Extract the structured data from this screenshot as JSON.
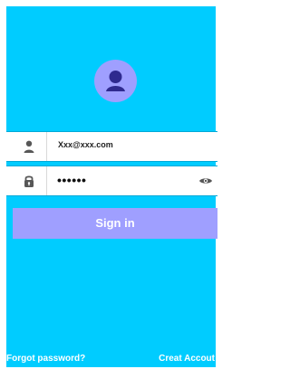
{
  "colors": {
    "background": "#00ccff",
    "accent": "#9f9fff",
    "field_background": "#ffffff",
    "text_light": "#ffffff",
    "text_dark": "#1f1f1f"
  },
  "avatar": {
    "icon": "user-avatar-icon"
  },
  "email": {
    "icon": "person-icon",
    "value": "Xxx@xxx.com"
  },
  "password": {
    "icon": "lock-icon",
    "value": "••••••",
    "visibility_icon": "eye-icon"
  },
  "signin": {
    "label": "Sign in"
  },
  "footer": {
    "forgot_password": "Forgot password?",
    "create_account": "Creat Accout"
  }
}
